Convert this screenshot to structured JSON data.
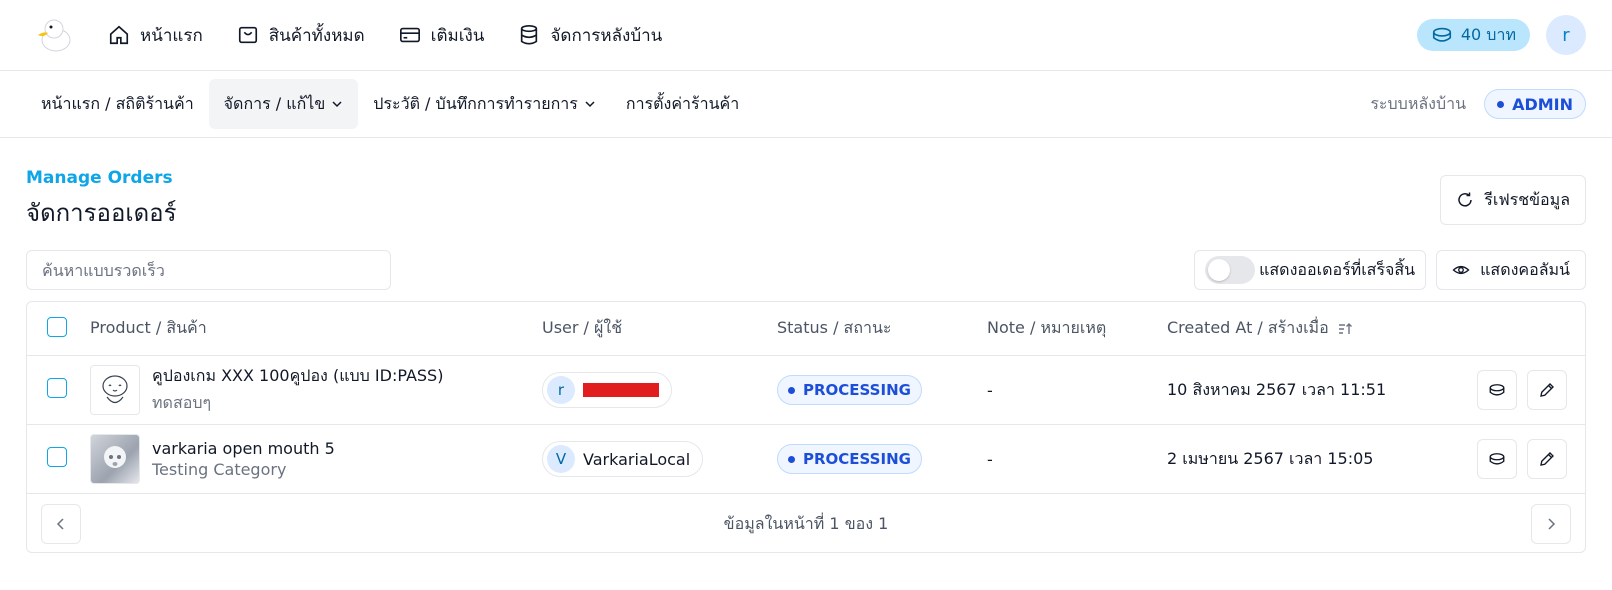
{
  "topnav": {
    "items": [
      {
        "label": "หน้าแรก",
        "icon": "home-icon"
      },
      {
        "label": "สินค้าทั้งหมด",
        "icon": "shop-icon"
      },
      {
        "label": "เติมเงิน",
        "icon": "credit-card-icon"
      },
      {
        "label": "จัดการหลังบ้าน",
        "icon": "database-icon"
      }
    ],
    "balance": "40 บาท",
    "avatar_letter": "r"
  },
  "subnav": {
    "items": [
      {
        "label": "หน้าแรก / สถิติร้านค้า",
        "has_chevron": false
      },
      {
        "label": "จัดการ / แก้ไข",
        "has_chevron": true,
        "active": true
      },
      {
        "label": "ประวัติ / บันทึกการทำรายการ",
        "has_chevron": true
      },
      {
        "label": "การตั้งค่าร้านค้า",
        "has_chevron": false
      }
    ],
    "system_label": "ระบบหลังบ้าน",
    "role_badge": "ADMIN"
  },
  "page": {
    "kicker": "Manage Orders",
    "title": "จัดการออเดอร์",
    "refresh_label": "รีเฟรชข้อมูล"
  },
  "toolbar": {
    "search_placeholder": "ค้นหาแบบรวดเร็ว",
    "toggle_label": "แสดงออเดอร์ที่เสร็จสิ้น",
    "columns_label": "แสดงคอลัมน์"
  },
  "table": {
    "headers": {
      "product": "Product / สินค้า",
      "user": "User / ผู้ใช้",
      "status": "Status / สถานะ",
      "note": "Note / หมายเหตุ",
      "created": "Created At / สร้างเมื่อ"
    },
    "rows": [
      {
        "product_name": "คูปองเกม XXX 100คูปอง (แบบ ID:PASS)",
        "product_category": "ทดสอบๆ",
        "user_letter": "r",
        "user_name": "",
        "user_redacted": true,
        "status": "PROCESSING",
        "note": "-",
        "created": "10 สิงหาคม 2567 เวลา 11:51"
      },
      {
        "product_name": "varkaria open mouth 5",
        "product_category": "Testing Category",
        "user_letter": "V",
        "user_name": "VarkariaLocal",
        "user_redacted": false,
        "status": "PROCESSING",
        "note": "-",
        "created": "2 เมษายน 2567 เวลา 15:05"
      }
    ],
    "pagination": "ข้อมูลในหน้าที่ 1 ของ 1"
  },
  "colors": {
    "accent": "#0ea5e9",
    "status_blue": "#1d4ed8",
    "balance_bg": "#bae6fd"
  }
}
